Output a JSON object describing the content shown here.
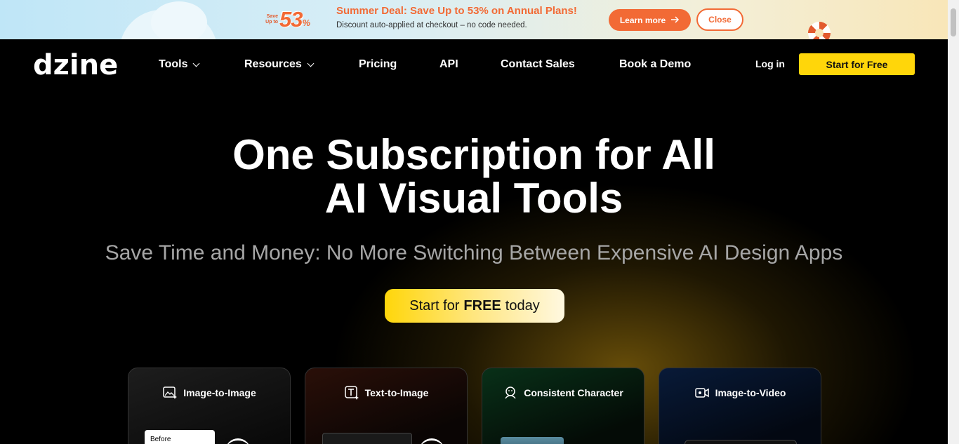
{
  "promo": {
    "badge_small": "Save Up to",
    "badge_number": "53",
    "badge_percent": "%",
    "title": "Summer Deal: Save Up to 53% on Annual Plans!",
    "subtitle": "Discount auto-applied at checkout – no code needed.",
    "learn_more": "Learn more",
    "learn_more_icon": "arrow-right-icon",
    "close": "Close"
  },
  "nav": {
    "logo": "dzine",
    "items": [
      {
        "label": "Tools",
        "dropdown": true
      },
      {
        "label": "Resources",
        "dropdown": true
      },
      {
        "label": "Pricing"
      },
      {
        "label": "API"
      },
      {
        "label": "Contact Sales"
      },
      {
        "label": "Book a Demo"
      }
    ],
    "login": "Log in",
    "start": "Start for Free"
  },
  "hero": {
    "title_line1": "One Subscription for All",
    "title_line2": "AI Visual Tools",
    "subtitle": "Save Time and Money: No More Switching Between Expensive AI Design Apps",
    "cta_prefix": "Start for",
    "cta_bold": "FREE",
    "cta_suffix": "today"
  },
  "cards": [
    {
      "label": "Image-to-Image",
      "icon": "image-sparkle-icon",
      "thumb_label": "Before"
    },
    {
      "label": "Text-to-Image",
      "icon": "text-sparkle-icon"
    },
    {
      "label": "Consistent Character",
      "icon": "character-icon"
    },
    {
      "label": "Image-to-Video",
      "icon": "video-icon"
    }
  ],
  "colors": {
    "accent": "#ffd60a",
    "promo_orange": "#f26a35"
  }
}
